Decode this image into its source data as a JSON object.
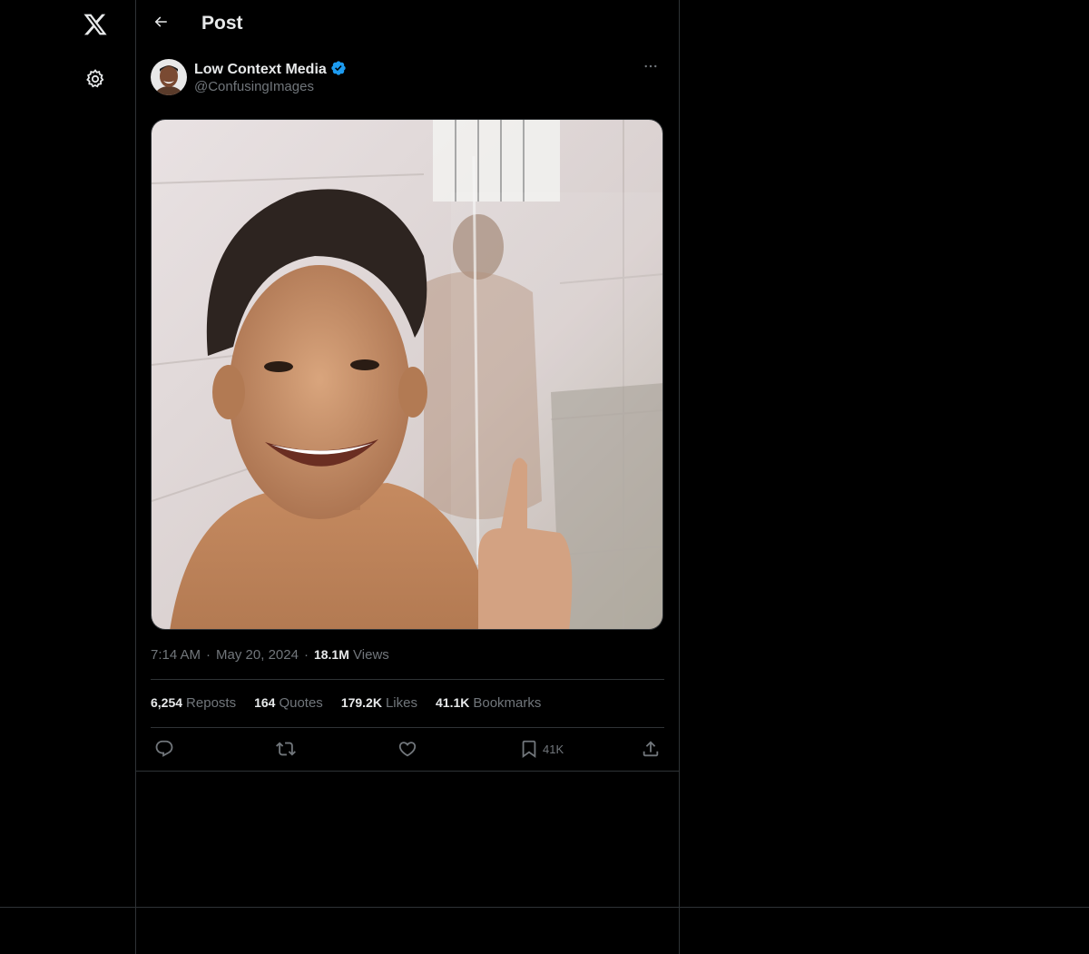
{
  "nav": {
    "logo_icon": "x-logo-icon",
    "settings_icon": "gear-icon"
  },
  "header": {
    "back_icon": "arrow-left-icon",
    "title": "Post"
  },
  "post": {
    "author": {
      "display_name": "Low Context Media",
      "handle": "@ConfusingImages",
      "verified": true,
      "verified_color": "#1d9bf0"
    },
    "more_icon": "more-horizontal-icon",
    "media_description_icon": "photo",
    "meta": {
      "time": "7:14 AM",
      "separator": "·",
      "date": "May 20, 2024",
      "views_count": "18.1M",
      "views_label": "Views"
    },
    "stats": [
      {
        "count": "6,254",
        "label": "Reposts"
      },
      {
        "count": "164",
        "label": "Quotes"
      },
      {
        "count": "179.2K",
        "label": "Likes"
      },
      {
        "count": "41.1K",
        "label": "Bookmarks"
      }
    ],
    "actions": {
      "reply_icon": "reply-icon",
      "repost_icon": "repost-icon",
      "like_icon": "heart-icon",
      "bookmark_icon": "bookmark-icon",
      "bookmark_count": "41K",
      "share_icon": "share-icon"
    }
  },
  "colors": {
    "background": "#000000",
    "border": "#2f3336",
    "text_primary": "#e7e9ea",
    "text_secondary": "#71767b",
    "accent": "#1d9bf0"
  }
}
